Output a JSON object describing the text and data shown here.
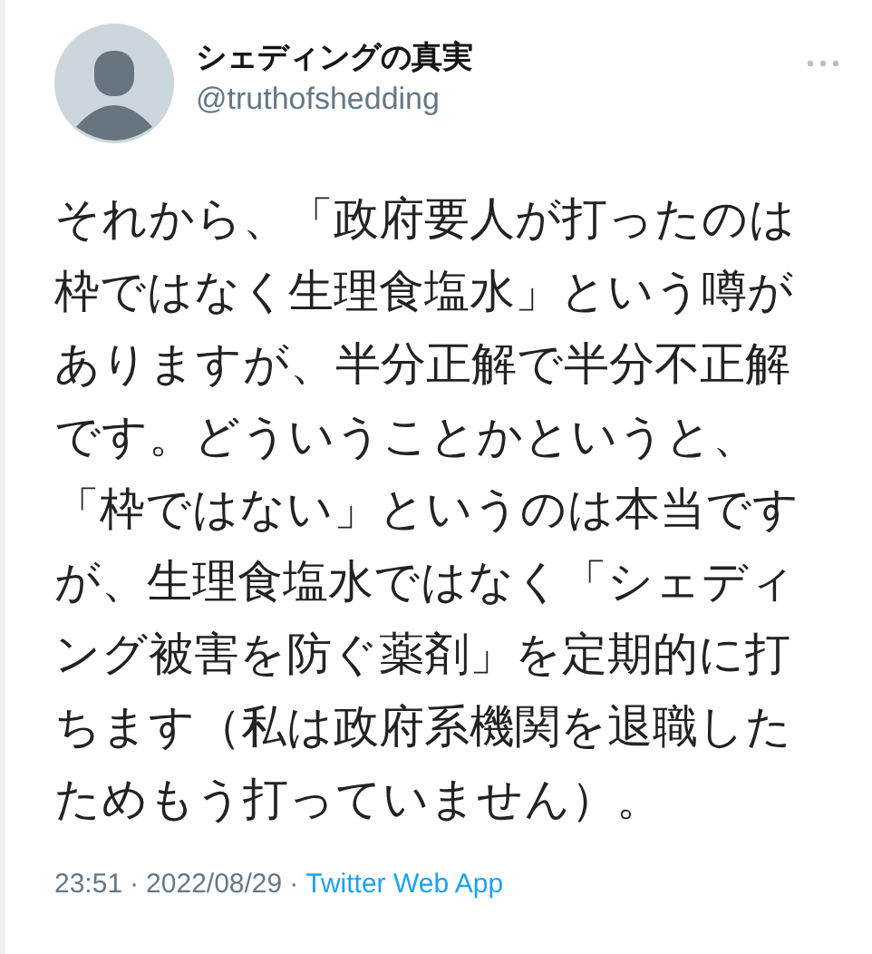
{
  "author": {
    "name": "シェディングの真実",
    "handle": "@truthofshedding"
  },
  "text": "それから、「政府要人が打ったのは枠ではなく生理食塩水」という噂がありますが、半分正解で半分不正解です。どういうことかというと、「枠ではない」というのは本当ですが、生理食塩水ではなく「シェディング被害を防ぐ薬剤」を定期的に打ちます（私は政府系機関を退職したためもう打っていません）。",
  "meta": {
    "time": "23:51",
    "separator_1": "·",
    "date": "2022/08/29",
    "separator_2": "·",
    "source": "Twitter Web App"
  }
}
